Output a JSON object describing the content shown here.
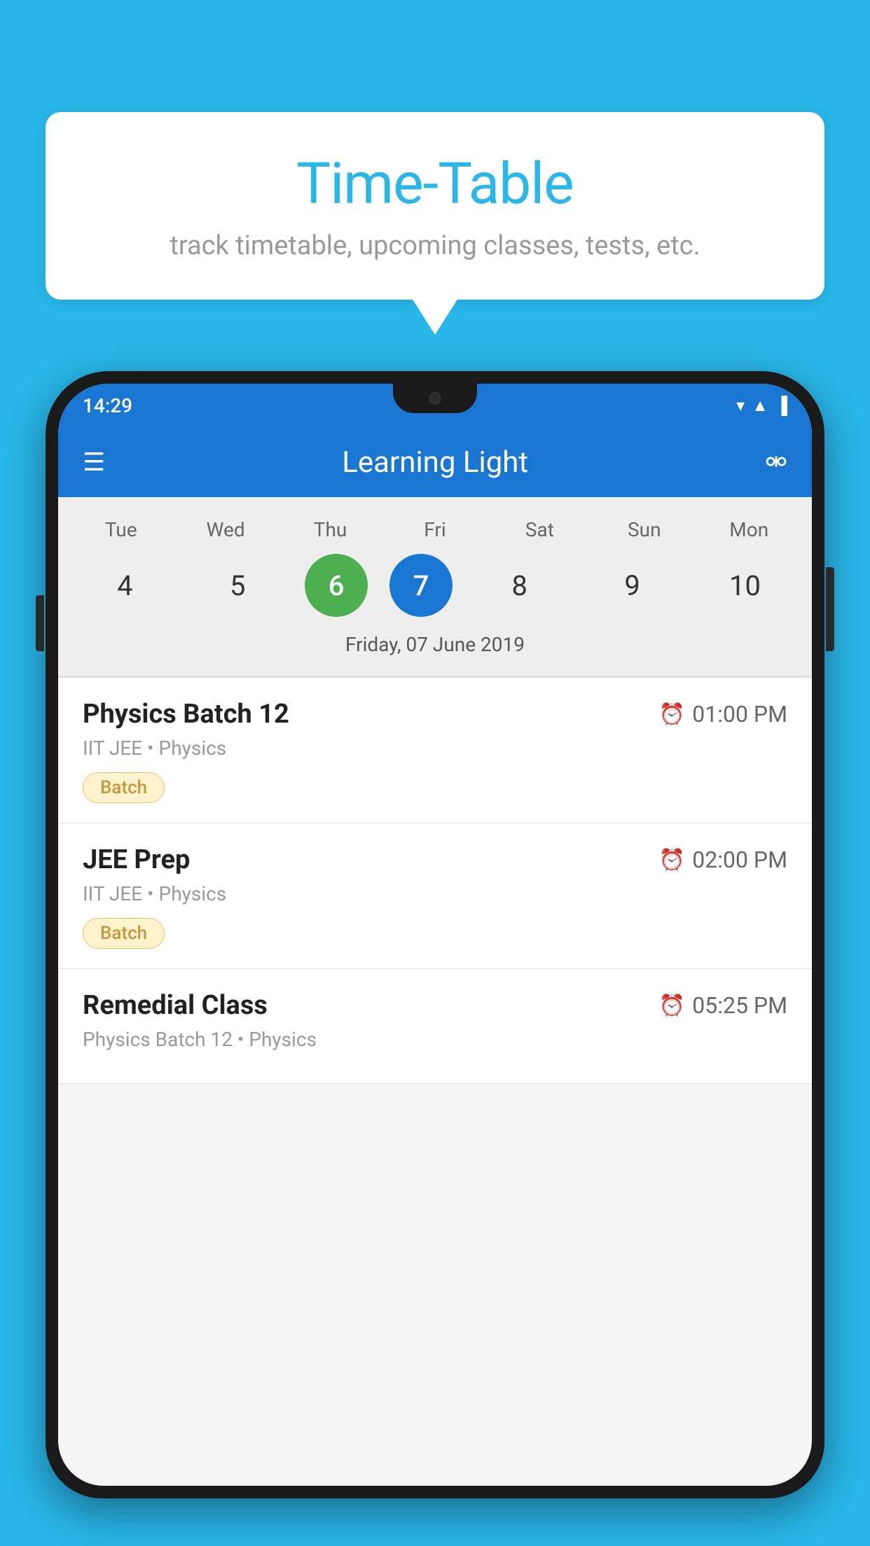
{
  "background_color": "#29b6e8",
  "bubble": {
    "title": "Time-Table",
    "subtitle": "track timetable, upcoming classes, tests, etc."
  },
  "phone": {
    "status_bar": {
      "time": "14:29",
      "icons": [
        "wifi",
        "signal",
        "battery"
      ]
    },
    "app_bar": {
      "title": "Learning Light",
      "menu_label": "≡",
      "search_label": "🔍"
    },
    "calendar": {
      "days": [
        {
          "short": "Tue",
          "num": "4"
        },
        {
          "short": "Wed",
          "num": "5"
        },
        {
          "short": "Thu",
          "num": "6",
          "state": "today"
        },
        {
          "short": "Fri",
          "num": "7",
          "state": "selected"
        },
        {
          "short": "Sat",
          "num": "8"
        },
        {
          "short": "Sun",
          "num": "9"
        },
        {
          "short": "Mon",
          "num": "10"
        }
      ],
      "selected_label": "Friday, 07 June 2019"
    },
    "schedule": [
      {
        "title": "Physics Batch 12",
        "time": "01:00 PM",
        "sub": "IIT JEE • Physics",
        "badge": "Batch"
      },
      {
        "title": "JEE Prep",
        "time": "02:00 PM",
        "sub": "IIT JEE • Physics",
        "badge": "Batch"
      },
      {
        "title": "Remedial Class",
        "time": "05:25 PM",
        "sub": "Physics Batch 12 • Physics",
        "badge": null
      }
    ]
  }
}
